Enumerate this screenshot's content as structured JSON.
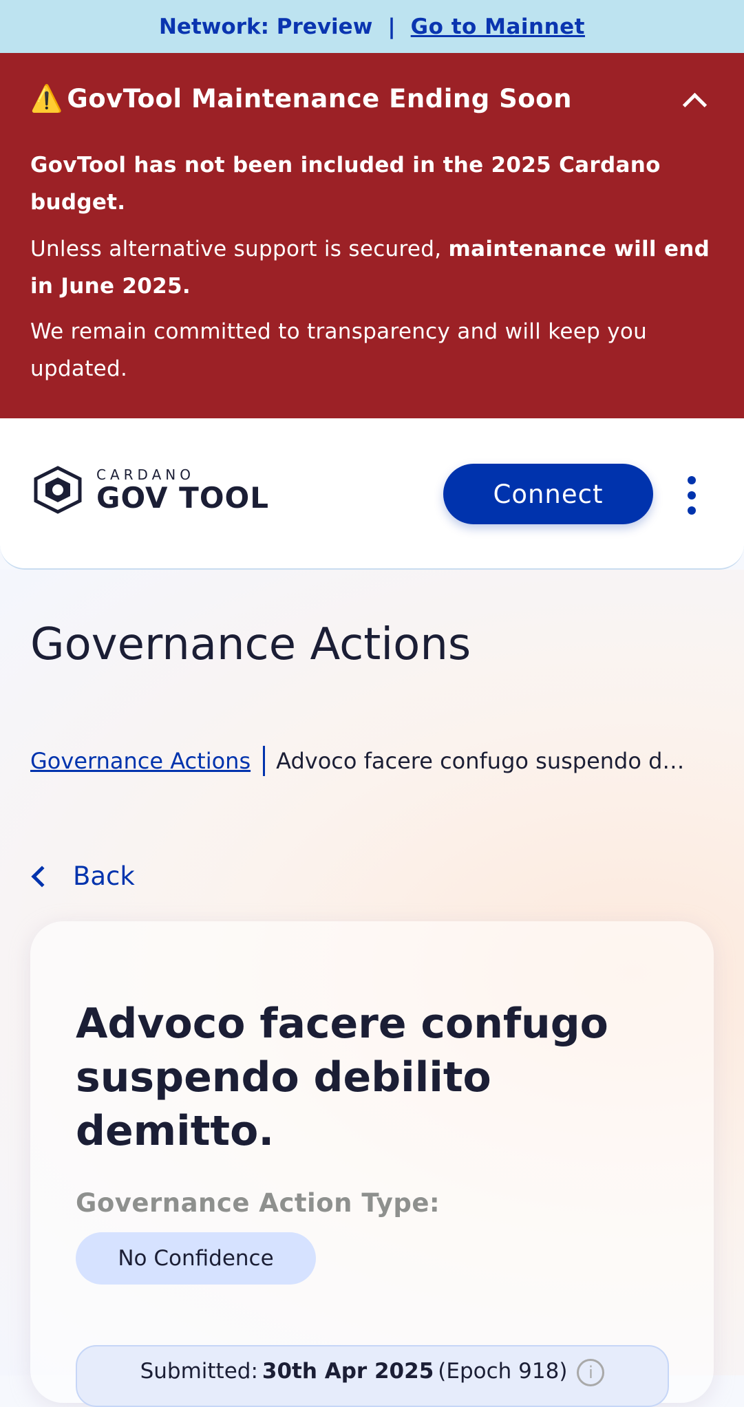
{
  "network_bar": {
    "label": "Network: Preview",
    "separator": "|",
    "link": "Go to Mainnet"
  },
  "alert": {
    "title": "GovTool Maintenance Ending Soon",
    "warning_icon": "⚠️",
    "p1": "GovTool has not been included in the 2025 Cardano budget.",
    "p2_regular": "Unless alternative support is secured, ",
    "p2_bold": "maintenance will end in June 2025.",
    "p3": "We remain committed to transparency and will keep you updated."
  },
  "header": {
    "logo_small": "CARDANO",
    "logo_big": "GOV TOOL",
    "connect_label": "Connect"
  },
  "page": {
    "title": "Governance Actions",
    "breadcrumb_link": "Governance Actions",
    "breadcrumb_current": "Advoco facere confugo suspendo debilito demitto.",
    "back_label": "Back"
  },
  "card": {
    "title": "Advoco facere confugo suspendo debilito demitto.",
    "type_label": "Governance Action Type:",
    "type_value": "No Confidence",
    "submitted_label": "Submitted:",
    "submitted_date": "30th Apr 2025",
    "submitted_epoch": "(Epoch 918)"
  },
  "colors": {
    "network_bar_bg": "#bde3f0",
    "alert_bg": "#9c2126",
    "primary": "#0033ad",
    "chip_bg": "#d6e2ff"
  }
}
